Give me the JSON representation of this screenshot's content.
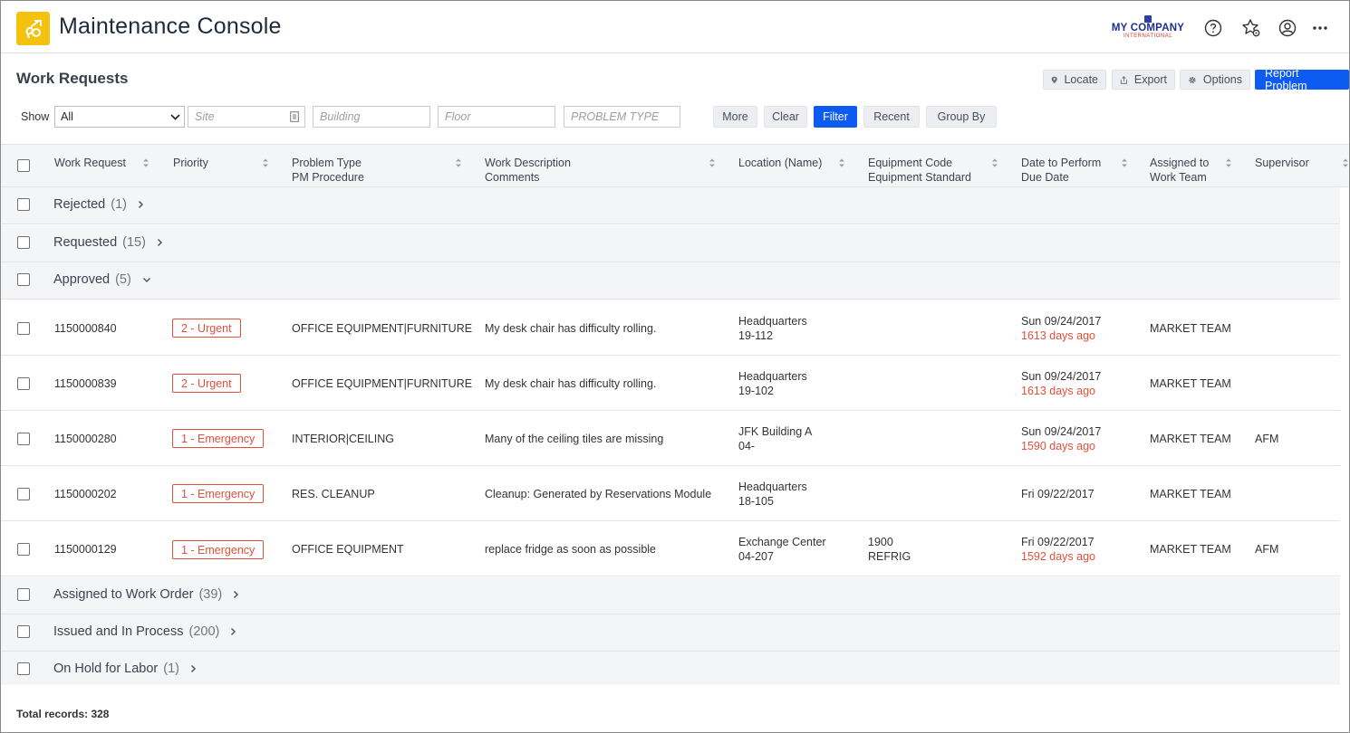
{
  "app": {
    "title": "Maintenance Console",
    "company_name": "MY COMPANY",
    "company_sub": "INTERNATIONAL",
    "header_icons": [
      "help-icon",
      "favorites-star-icon",
      "user-profile-icon",
      "more-icon"
    ]
  },
  "page": {
    "title": "Work Requests",
    "actions": {
      "locate": "Locate",
      "export": "Export",
      "options": "Options",
      "report_problem": "Report Problem"
    }
  },
  "filters": {
    "show_label": "Show",
    "show_value": "All",
    "site_placeholder": "Site",
    "building_placeholder": "Building",
    "floor_placeholder": "Floor",
    "problem_type_placeholder": "PROBLEM TYPE",
    "more": "More",
    "clear": "Clear",
    "filter": "Filter",
    "recent": "Recent",
    "group_by": "Group By"
  },
  "columns": {
    "work_request": "Work Request",
    "priority": "Priority",
    "problem_type": "Problem Type",
    "pm_procedure": "PM Procedure",
    "work_description": "Work Description",
    "comments": "Comments",
    "location": "Location (Name)",
    "equipment_code": "Equipment Code",
    "equipment_standard": "Equipment Standard",
    "date_to_perform": "Date to Perform",
    "due_date": "Due Date",
    "assigned_to": "Assigned to",
    "work_team": "Work Team",
    "supervisor": "Supervisor"
  },
  "groups": {
    "rejected": {
      "label": "Rejected",
      "count": "(1)"
    },
    "requested": {
      "label": "Requested",
      "count": "(15)"
    },
    "approved": {
      "label": "Approved",
      "count": "(5)"
    },
    "assigned": {
      "label": "Assigned to Work Order",
      "count": "(39)"
    },
    "issued": {
      "label": "Issued and In Process",
      "count": "(200)"
    },
    "onhold": {
      "label": "On Hold for Labor",
      "count": "(1)"
    }
  },
  "rows": [
    {
      "id": "1150000840",
      "priority": "2 - Urgent",
      "problem_type": "OFFICE EQUIPMENT|FURNITURE",
      "description": "My desk chair has difficulty rolling.",
      "location_1": "Headquarters",
      "location_2": "19-112",
      "equip_1": "",
      "equip_2": "",
      "date": "Sun 09/24/2017",
      "days": "1613 days ago",
      "team": "MARKET TEAM",
      "supervisor": ""
    },
    {
      "id": "1150000839",
      "priority": "2 - Urgent",
      "problem_type": "OFFICE EQUIPMENT|FURNITURE",
      "description": "My desk chair has difficulty rolling.",
      "location_1": "Headquarters",
      "location_2": "19-102",
      "equip_1": "",
      "equip_2": "",
      "date": "Sun 09/24/2017",
      "days": "1613 days ago",
      "team": "MARKET TEAM",
      "supervisor": ""
    },
    {
      "id": "1150000280",
      "priority": "1 - Emergency",
      "problem_type": "INTERIOR|CEILING",
      "description": "Many of the ceiling tiles are missing",
      "location_1": "JFK Building A",
      "location_2": "04-",
      "equip_1": "",
      "equip_2": "",
      "date": "Sun 09/24/2017",
      "days": "1590 days ago",
      "team": "MARKET TEAM",
      "supervisor": "AFM"
    },
    {
      "id": "1150000202",
      "priority": "1 - Emergency",
      "problem_type": "RES. CLEANUP",
      "description": "Cleanup: Generated by Reservations Module",
      "location_1": "Headquarters",
      "location_2": "18-105",
      "equip_1": "",
      "equip_2": "",
      "date": "Fri 09/22/2017",
      "days": "",
      "team": "MARKET TEAM",
      "supervisor": ""
    },
    {
      "id": "1150000129",
      "priority": "1 - Emergency",
      "problem_type": "OFFICE EQUIPMENT",
      "description": "replace fridge as soon as possible",
      "location_1": "Exchange Center",
      "location_2": "04-207",
      "equip_1": "1900",
      "equip_2": "REFRIG",
      "date": "Fri 09/22/2017",
      "days": "1592 days ago",
      "team": "MARKET TEAM",
      "supervisor": "AFM"
    }
  ],
  "footer": {
    "total": "Total records: 328"
  },
  "colors": {
    "accent": "#0d5cf2",
    "logo": "#f4c20d",
    "danger": "#e0503c"
  }
}
